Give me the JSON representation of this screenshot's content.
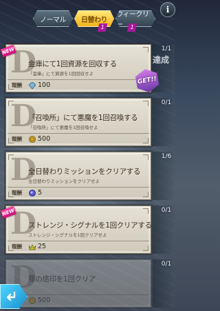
{
  "tabs": [
    {
      "label": "ノーマル",
      "active": false,
      "badge": ""
    },
    {
      "label": "日替わり",
      "active": true,
      "badge": "1"
    },
    {
      "label": "ウィークリー",
      "active": false,
      "badge": "1"
    }
  ],
  "info_label": "i",
  "missions": [
    {
      "title": "金庫にて1回資源を回収する",
      "subtitle": "「金庫」にて資源を1回回収せよ",
      "reward_label": "報酬",
      "reward_icon": "diamond-icon",
      "reward_amount": "100",
      "progress": "1/1",
      "is_new": true,
      "new_label": "NEW",
      "status_label": "達成",
      "get_label": "GET!!"
    },
    {
      "title": "「召喚所」にて悪魔を1回召喚する",
      "subtitle": "「召喚所」にて悪魔を1回召喚せよ",
      "reward_label": "報酬",
      "reward_icon": "coin-icon",
      "reward_amount": "500",
      "progress": "0/1",
      "is_new": false
    },
    {
      "title": "全日替わりミッションをクリアする",
      "subtitle": "全日替わりミッションをクリアせよ",
      "reward_label": "報酬",
      "reward_icon": "gem-icon",
      "reward_amount": "5",
      "progress": "1/6",
      "is_new": false
    },
    {
      "title": "ストレンジ・シグナルを1回クリアする",
      "subtitle": "ストレンジ・シグナルを1回クリアせよ",
      "reward_label": "報酬",
      "reward_icon": "crown-icon",
      "reward_amount": "25",
      "progress": "0/1",
      "is_new": true,
      "new_label": "NEW"
    },
    {
      "title": "罪の烙印を1回クリア",
      "subtitle": "",
      "reward_label": "報酬",
      "reward_icon": "coin-icon",
      "reward_amount": "500",
      "progress": "0/1",
      "is_new": false
    }
  ],
  "colors": {
    "tab_active": "#f2b21a",
    "badge": "#a8189a",
    "new_tag": "#e0208e",
    "back_button": "#2aa8e0",
    "get_badge": "#9a5ac8"
  }
}
